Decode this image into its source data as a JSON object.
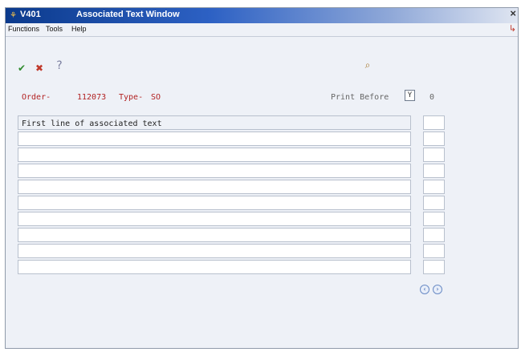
{
  "window": {
    "id": "V401",
    "title": "Associated Text Window",
    "close_label": "×"
  },
  "menu": {
    "items": [
      "Functions",
      "Tools",
      "Help"
    ]
  },
  "toolbar": {
    "ok": "✔",
    "cancel": "✖",
    "help": "?",
    "search": "⌕"
  },
  "header": {
    "order_label": "Order-",
    "order_value": "112073",
    "type_label": "Type-",
    "type_value": "SO",
    "print_label": "Print Before",
    "print_value": "Y",
    "count": "0"
  },
  "rows": [
    {
      "text": "First line of associated text"
    },
    {
      "text": ""
    },
    {
      "text": ""
    },
    {
      "text": ""
    },
    {
      "text": ""
    },
    {
      "text": ""
    },
    {
      "text": ""
    },
    {
      "text": ""
    },
    {
      "text": ""
    },
    {
      "text": ""
    }
  ],
  "nav": {
    "prev": "‹",
    "next": "›"
  }
}
